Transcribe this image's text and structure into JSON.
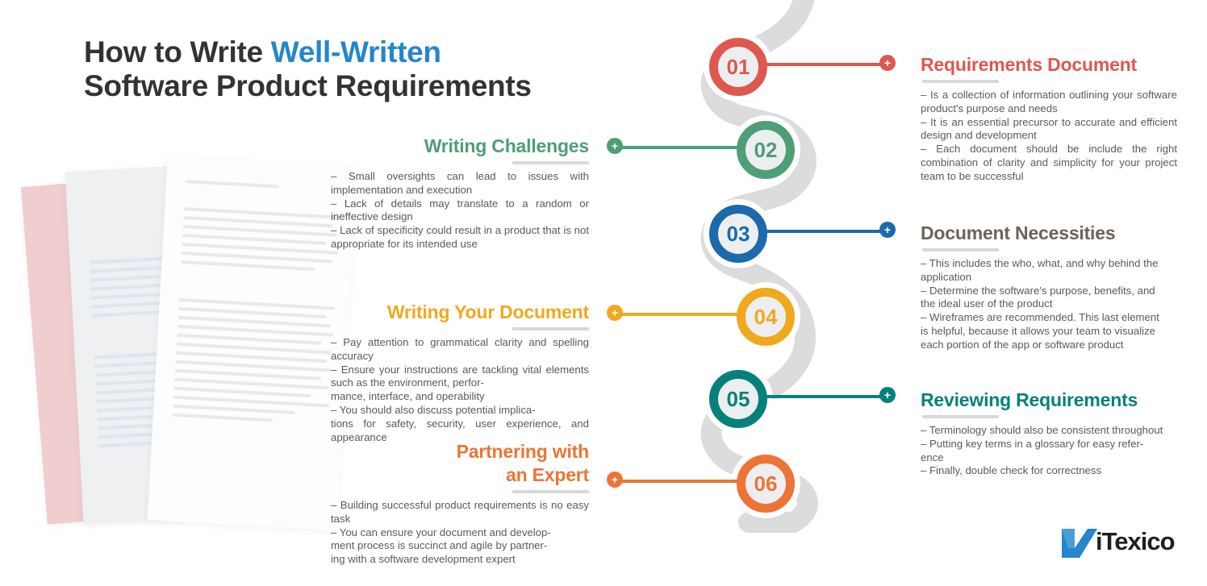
{
  "title": {
    "line1_a": "How to Write ",
    "line1_b": "Well-Written",
    "line2": "Software Product Requirements",
    "accent_color": "#2486cb",
    "base_color": "#333333"
  },
  "steps": [
    {
      "number": "01",
      "side": "right",
      "color": "#dd584f",
      "heading": "Requirements Document",
      "body": "– Is a collection of information outlining your software product's purpose and needs\n– It is an essential precursor to accurate and efficient design and development\n– Each document should be include the right combination of clarity and simplicity for your project team to be successful",
      "plus_label": "+"
    },
    {
      "number": "02",
      "side": "left",
      "color": "#4e9e78",
      "heading": "Writing Challenges",
      "body": "– Small oversights can lead to issues with implementation and execution\n– Lack of details may translate to a random or ineffective design\n– Lack of specificity could result in a product that is not appropriate for its intended use",
      "plus_label": "+"
    },
    {
      "number": "03",
      "side": "right",
      "color": "#1b6aab",
      "heading": "Document Necessities",
      "heading_color": "#6e6259",
      "body": "– This includes the who, what, and why behind the application\n– Determine the software's purpose, benefits, and the ideal user of the product\n– Wireframes are recommended. This last element is helpful, because it allows your team to visualize each portion of the app or software product",
      "plus_label": "+"
    },
    {
      "number": "04",
      "side": "left",
      "color": "#f0a91c",
      "heading": "Writing Your Document",
      "body": "– Pay attention to grammatical clarity and spelling accuracy\n– Ensure your instructions are tackling vital elements such as the environment, perfor-\nmance, interface, and operability\n– You should also discuss potential implica-\ntions for safety, security, user experience, and appearance",
      "plus_label": "+"
    },
    {
      "number": "05",
      "side": "right",
      "color": "#05817b",
      "heading": "Reviewing Requirements",
      "body": "– Terminology should also be consistent throughout\n– Putting key terms in a glossary for easy refer-\nence\n– Finally, double check for correctness",
      "plus_label": "+"
    },
    {
      "number": "06",
      "side": "left",
      "color": "#ed7434",
      "heading": "Partnering with\nan Expert",
      "body": "– Building successful product requirements is no easy task\n– You can ensure your document and develop-\nment process is succinct and agile by partner-\ning with a software development expert",
      "plus_label": "+"
    }
  ],
  "logo": {
    "text": "iTexico",
    "mark": "n-swoosh-mark",
    "mark_color": "#2486cb"
  },
  "decor": {
    "paper_stack": "stacked-document-sheets",
    "path": "winding-timeline-path",
    "path_color": "#dcdcdc"
  }
}
